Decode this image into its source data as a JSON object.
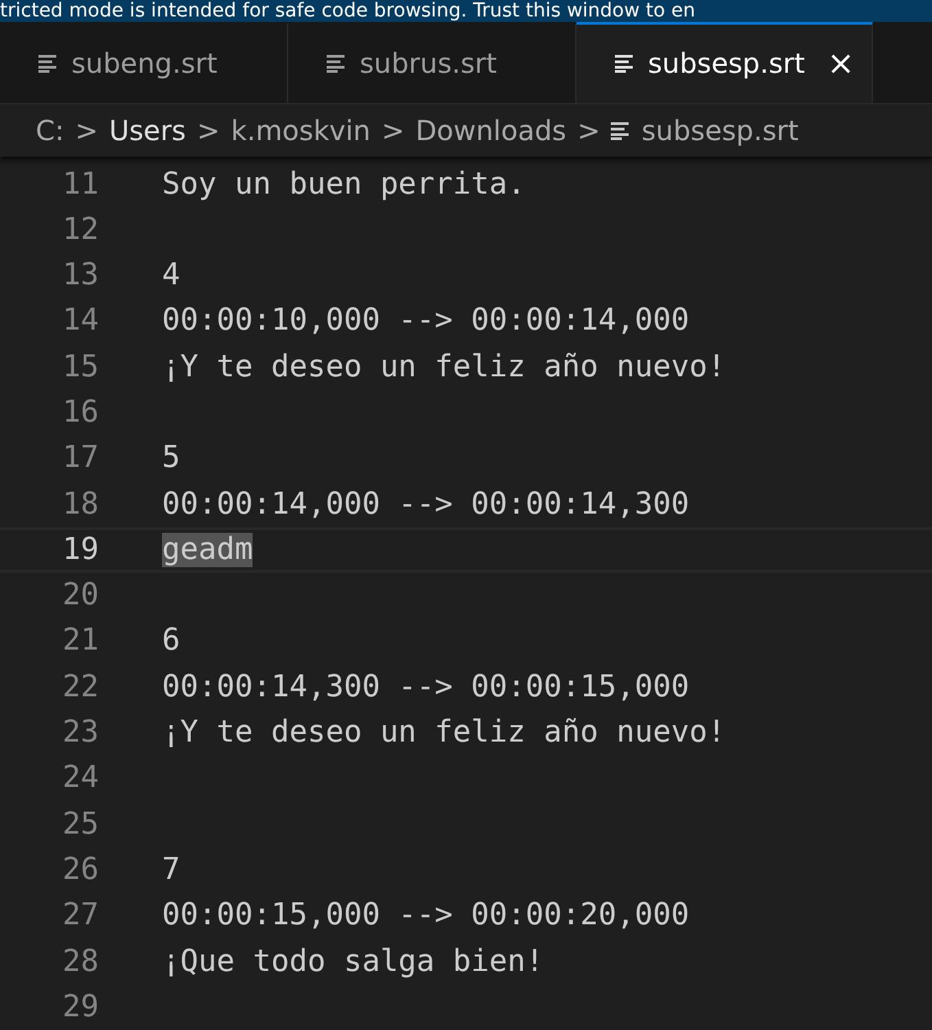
{
  "banner": {
    "text": "tricted mode is intended for safe code browsing. Trust this window to en"
  },
  "tabs": [
    {
      "label": "subeng.srt",
      "selected": false
    },
    {
      "label": "subrus.srt",
      "selected": false
    },
    {
      "label": "subsesp.srt",
      "selected": true,
      "close": "×"
    }
  ],
  "breadcrumb": [
    {
      "label": "C:",
      "bold": false,
      "kind": "folder"
    },
    {
      "label": "Users",
      "bold": true,
      "kind": "folder"
    },
    {
      "label": "k.moskvin",
      "bold": false,
      "kind": "folder"
    },
    {
      "label": "Downloads",
      "bold": false,
      "kind": "folder"
    },
    {
      "label": "subsesp.srt",
      "bold": false,
      "kind": "file"
    }
  ],
  "separator": ">",
  "lines": [
    {
      "number": "11",
      "text": "Soy un buen perrita.",
      "current": false,
      "selected": false
    },
    {
      "number": "12",
      "current": false
    },
    {
      "number": "13",
      "text": "4",
      "current": false,
      "selected": false
    },
    {
      "number": "14",
      "text": "00:00:10,000 --> 00:00:14,000",
      "current": false,
      "selected": false
    },
    {
      "number": "15",
      "text": "¡Y te deseo un feliz año nuevo!",
      "current": false,
      "selected": false
    },
    {
      "number": "16",
      "current": false
    },
    {
      "number": "17",
      "text": "5",
      "current": false,
      "selected": false
    },
    {
      "number": "18",
      "text": "00:00:14,000 --> 00:00:14,300",
      "current": false,
      "selected": false
    },
    {
      "number": "19",
      "text": "geadm",
      "current": true,
      "selected": true
    },
    {
      "number": "20",
      "current": false
    },
    {
      "number": "21",
      "text": "6",
      "current": false,
      "selected": false
    },
    {
      "number": "22",
      "text": "00:00:14,300 --> 00:00:15,000",
      "current": false,
      "selected": false
    },
    {
      "number": "23",
      "text": "¡Y te deseo un feliz año nuevo!",
      "current": false,
      "selected": false
    },
    {
      "number": "24",
      "current": false
    },
    {
      "number": "25",
      "current": false
    },
    {
      "number": "26",
      "text": "7",
      "current": false,
      "selected": false
    },
    {
      "number": "27",
      "text": "00:00:15,000 --> 00:00:20,000",
      "current": false,
      "selected": false
    },
    {
      "number": "28",
      "text": "¡Que todo salga bien!",
      "current": false,
      "selected": false
    },
    {
      "number": "29",
      "current": false
    }
  ]
}
